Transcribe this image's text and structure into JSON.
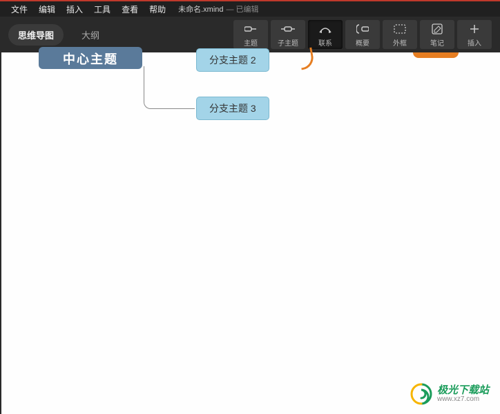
{
  "menu": {
    "file": "文件",
    "edit": "编辑",
    "insert": "插入",
    "tools": "工具",
    "view": "查看",
    "help": "帮助"
  },
  "doc": {
    "title": "未命名.xmind",
    "status": "— 已编辑"
  },
  "viewTabs": {
    "mindmap": "思维导图",
    "outline": "大纲"
  },
  "tools": {
    "topic": "主题",
    "subtopic": "子主题",
    "relationship": "联系",
    "summary": "概要",
    "boundary": "外框",
    "notes": "笔记",
    "insert": "插入"
  },
  "nodes": {
    "central": "中心主题",
    "branch2": "分支主题 2",
    "branch3": "分支主题 3"
  },
  "watermark": {
    "cn": "极光下载站",
    "en": "www.xz7.com"
  }
}
